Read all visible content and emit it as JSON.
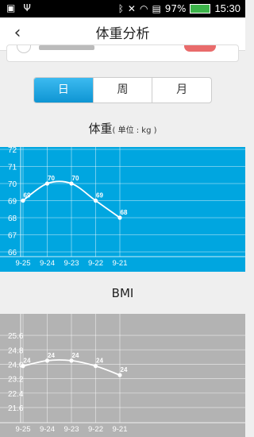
{
  "status_bar": {
    "battery": "97%",
    "time": "15:30",
    "icons": [
      "image-icon",
      "usb-icon",
      "bluetooth-icon",
      "mute-icon",
      "wifi-icon",
      "notification-icon",
      "battery-icon"
    ]
  },
  "header": {
    "title": "体重分析",
    "back_icon": "chevron-left-icon"
  },
  "tabs": [
    {
      "label": "日",
      "active": true
    },
    {
      "label": "周",
      "active": false
    },
    {
      "label": "月",
      "active": false
    }
  ],
  "weight_title": "体重",
  "weight_unit": "( 单位 : kg )",
  "bmi_title": "BMI",
  "colors": {
    "weight_bg": "#00a6e0",
    "bmi_bg": "#b3b3b3",
    "tab_active": "#1aa3e0",
    "line": "#ffffff"
  },
  "chart_data": [
    {
      "type": "line",
      "title": "体重",
      "categories": [
        "9-25",
        "9-24",
        "9-23",
        "9-22",
        "9-21"
      ],
      "series": [
        {
          "values": [
            69,
            70,
            70,
            69,
            68
          ]
        }
      ],
      "point_labels": [
        "69",
        "70",
        "70",
        "69",
        "68"
      ],
      "ytick_labels": [
        "72",
        "71",
        "70",
        "69",
        "68",
        "67",
        "66"
      ],
      "ylim": [
        66,
        72
      ],
      "grid": true
    },
    {
      "type": "line",
      "title": "BMI",
      "categories": [
        "9-25",
        "9-24",
        "9-23",
        "9-22",
        "9-21"
      ],
      "series": [
        {
          "values": [
            23.9,
            24.2,
            24.2,
            23.9,
            23.4
          ]
        }
      ],
      "point_labels": [
        "24",
        "24",
        "24",
        "24",
        "24"
      ],
      "ytick_labels": [
        "25.6",
        "24.8",
        "24.0",
        "23.2",
        "22.4",
        "21.6"
      ],
      "ylim": [
        21.2,
        26.0
      ],
      "grid": true
    }
  ]
}
